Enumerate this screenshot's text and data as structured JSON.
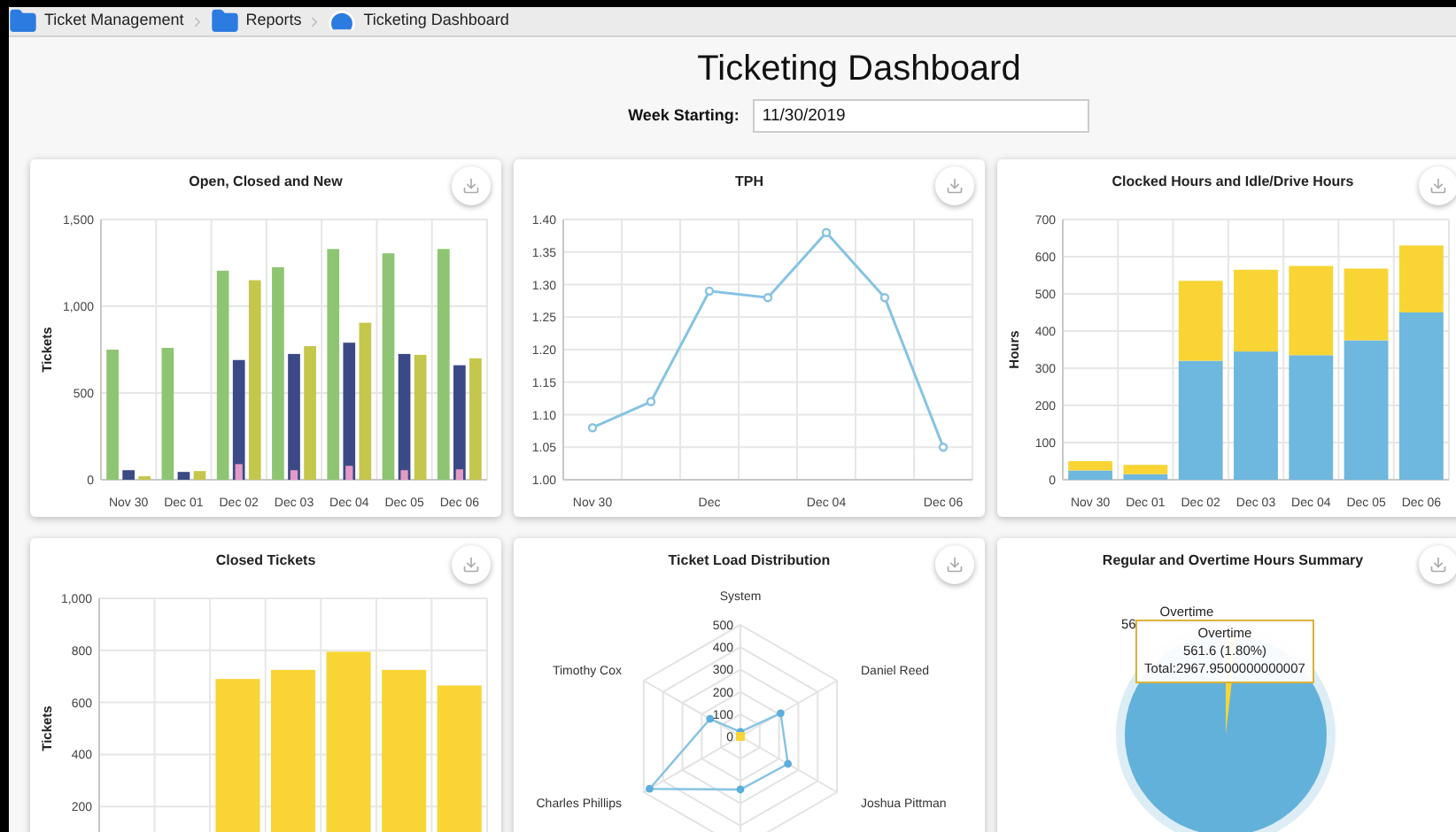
{
  "breadcrumb": [
    {
      "label": "Ticket Management",
      "kind": "folder"
    },
    {
      "label": "Reports",
      "kind": "folder"
    },
    {
      "label": "Ticketing Dashboard",
      "kind": "dashboard"
    }
  ],
  "title": "Ticketing Dashboard",
  "week": {
    "label": "Week Starting:",
    "value": "11/30/2019"
  },
  "cards": [
    {
      "kind": "chart",
      "chart_data": {
        "type": "bar",
        "title": "Open, Closed and New",
        "ylabel": "Tickets",
        "grid": true,
        "categories": [
          "Nov 30",
          "Dec 01",
          "Dec 02",
          "Dec 03",
          "Dec 04",
          "Dec 05",
          "Dec 06"
        ],
        "ylim": [
          0,
          1500
        ],
        "yticks": [
          0,
          500,
          {
            "value": 1000,
            "label": "1,000"
          },
          {
            "value": 1500,
            "label": "1,500"
          }
        ],
        "series": [
          {
            "color": "#8dc572",
            "values": [
              750,
              760,
              1205,
              1225,
              1330,
              1305,
              1330
            ]
          },
          {
            "color": "#3b4a86",
            "values": [
              55,
              45,
              690,
              725,
              790,
              725,
              660
            ]
          },
          {
            "color": "#c5c64c",
            "values": [
              20,
              50,
              1150,
              770,
              905,
              720,
              700
            ]
          },
          {
            "color": "#e39bc6",
            "values": [
              0,
              0,
              90,
              55,
              80,
              55,
              60
            ]
          }
        ]
      }
    },
    {
      "kind": "chart",
      "chart_data": {
        "type": "line",
        "title": "TPH",
        "grid": true,
        "categories": [
          "Nov 30",
          null,
          "Dec",
          null,
          "Dec 04",
          null,
          "Dec 06"
        ],
        "ylim": [
          1,
          1.4
        ],
        "yticks": [
          {
            "value": 1,
            "label": "1.00"
          },
          {
            "value": 1.05,
            "label": "1.05"
          },
          {
            "value": 1.1,
            "label": "1.10"
          },
          {
            "value": 1.15,
            "label": "1.15"
          },
          {
            "value": 1.2,
            "label": "1.20"
          },
          {
            "value": 1.25,
            "label": "1.25"
          },
          {
            "value": 1.3,
            "label": "1.30"
          },
          {
            "value": 1.35,
            "label": "1.35"
          },
          {
            "value": 1.4,
            "label": "1.40"
          }
        ],
        "series": [
          {
            "color": "#86c3e3",
            "marker": "circle",
            "values": [
              1.08,
              1.12,
              1.29,
              1.28,
              1.38,
              1.28,
              1.05
            ]
          }
        ]
      }
    },
    {
      "kind": "chart",
      "chart_data": {
        "type": "bar",
        "stacked": true,
        "title": "Clocked Hours and Idle/Drive Hours",
        "ylabel": "Hours",
        "grid": true,
        "categories": [
          "Nov 30",
          "Dec 01",
          "Dec 02",
          "Dec 03",
          "Dec 04",
          "Dec 05",
          "Dec 06"
        ],
        "ylim": [
          0,
          700
        ],
        "yticks": [
          0,
          100,
          200,
          300,
          400,
          500,
          600,
          700
        ],
        "series": [
          {
            "color": "#6eb7de",
            "values": [
              25,
              15,
              320,
              345,
              335,
              375,
              450
            ]
          },
          {
            "color": "#f8d535",
            "values": [
              25,
              25,
              215,
              220,
              240,
              193,
              180
            ]
          }
        ]
      }
    },
    {
      "kind": "chart",
      "chart_data": {
        "type": "bar",
        "title": "Closed Tickets",
        "ylabel": "Tickets",
        "grid": true,
        "ylim": [
          0,
          1000
        ],
        "yticks": [
          200,
          400,
          600,
          800,
          {
            "value": 1000,
            "label": "1,000"
          }
        ],
        "series": [
          {
            "color": "#f8d535",
            "values": [
              0,
              0,
              690,
              725,
              795,
              725,
              665
            ]
          }
        ]
      }
    },
    {
      "kind": "radar",
      "title": "Ticket Load Distribution",
      "axis_labels": [
        "System",
        "Timothy Cox",
        "Daniel Reed",
        "Charles Phillips",
        "Joshua Pittman"
      ],
      "ticks": [
        "500",
        "400",
        "300",
        "200",
        "100",
        "0"
      ]
    },
    {
      "kind": "pie",
      "title": "Regular and Overtime Hours Summary",
      "slice_label": "Overtime",
      "value_label": "56",
      "tooltip": [
        "Overtime",
        "561.6 (1.80%)",
        "Total:2967.9500000000007"
      ]
    }
  ]
}
